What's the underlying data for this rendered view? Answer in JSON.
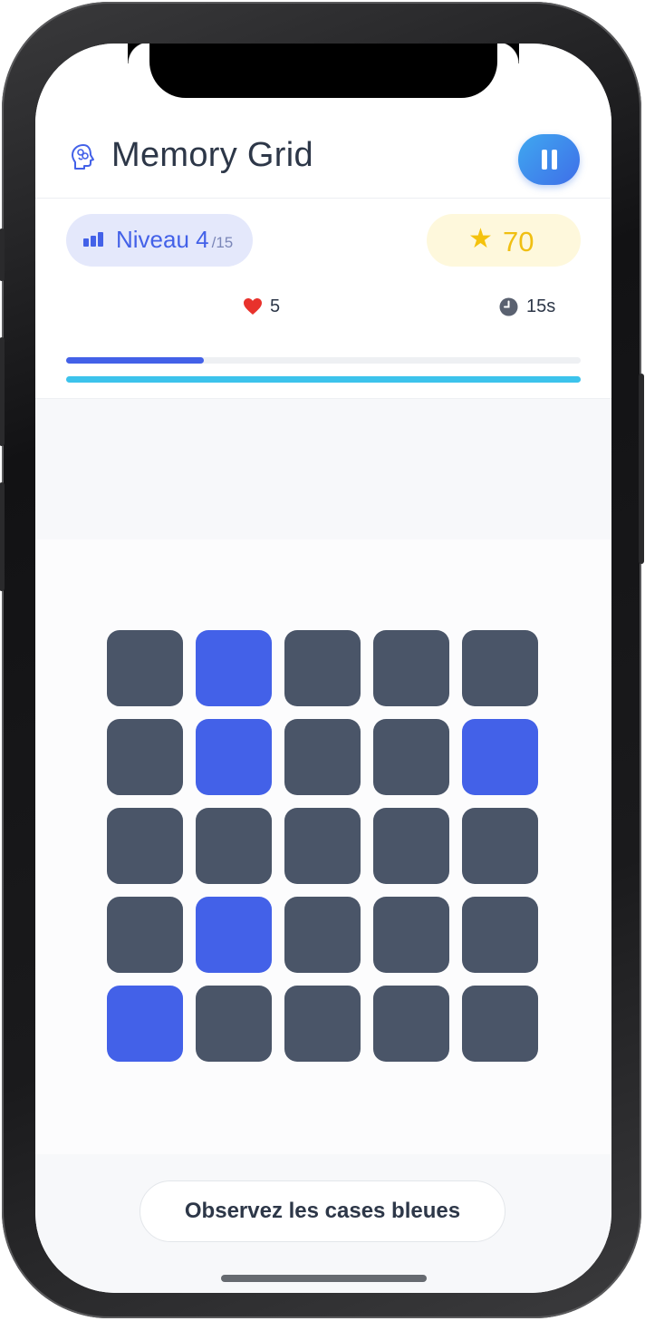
{
  "header": {
    "title": "Memory Grid",
    "brain_icon": "brain-icon",
    "pause_icon": "pause-icon"
  },
  "stats": {
    "level_label": "Niveau 4",
    "level_total": "/15",
    "score": "70",
    "lives": "5",
    "timer": "15s",
    "level_progress": 0.267,
    "time_remaining_fraction": 1.0
  },
  "grid": {
    "rows": 5,
    "cols": 5,
    "cells": [
      [
        0,
        1,
        0,
        0,
        0
      ],
      [
        0,
        1,
        0,
        0,
        1
      ],
      [
        0,
        0,
        0,
        0,
        0
      ],
      [
        0,
        1,
        0,
        0,
        0
      ],
      [
        1,
        0,
        0,
        0,
        0
      ]
    ]
  },
  "footer": {
    "instruction": "Observez les cases bleues"
  },
  "colors": {
    "accent": "#4361e8",
    "tile": "#4a5568",
    "timer_bar": "#3cc3ec",
    "score": "#f0bf12"
  }
}
